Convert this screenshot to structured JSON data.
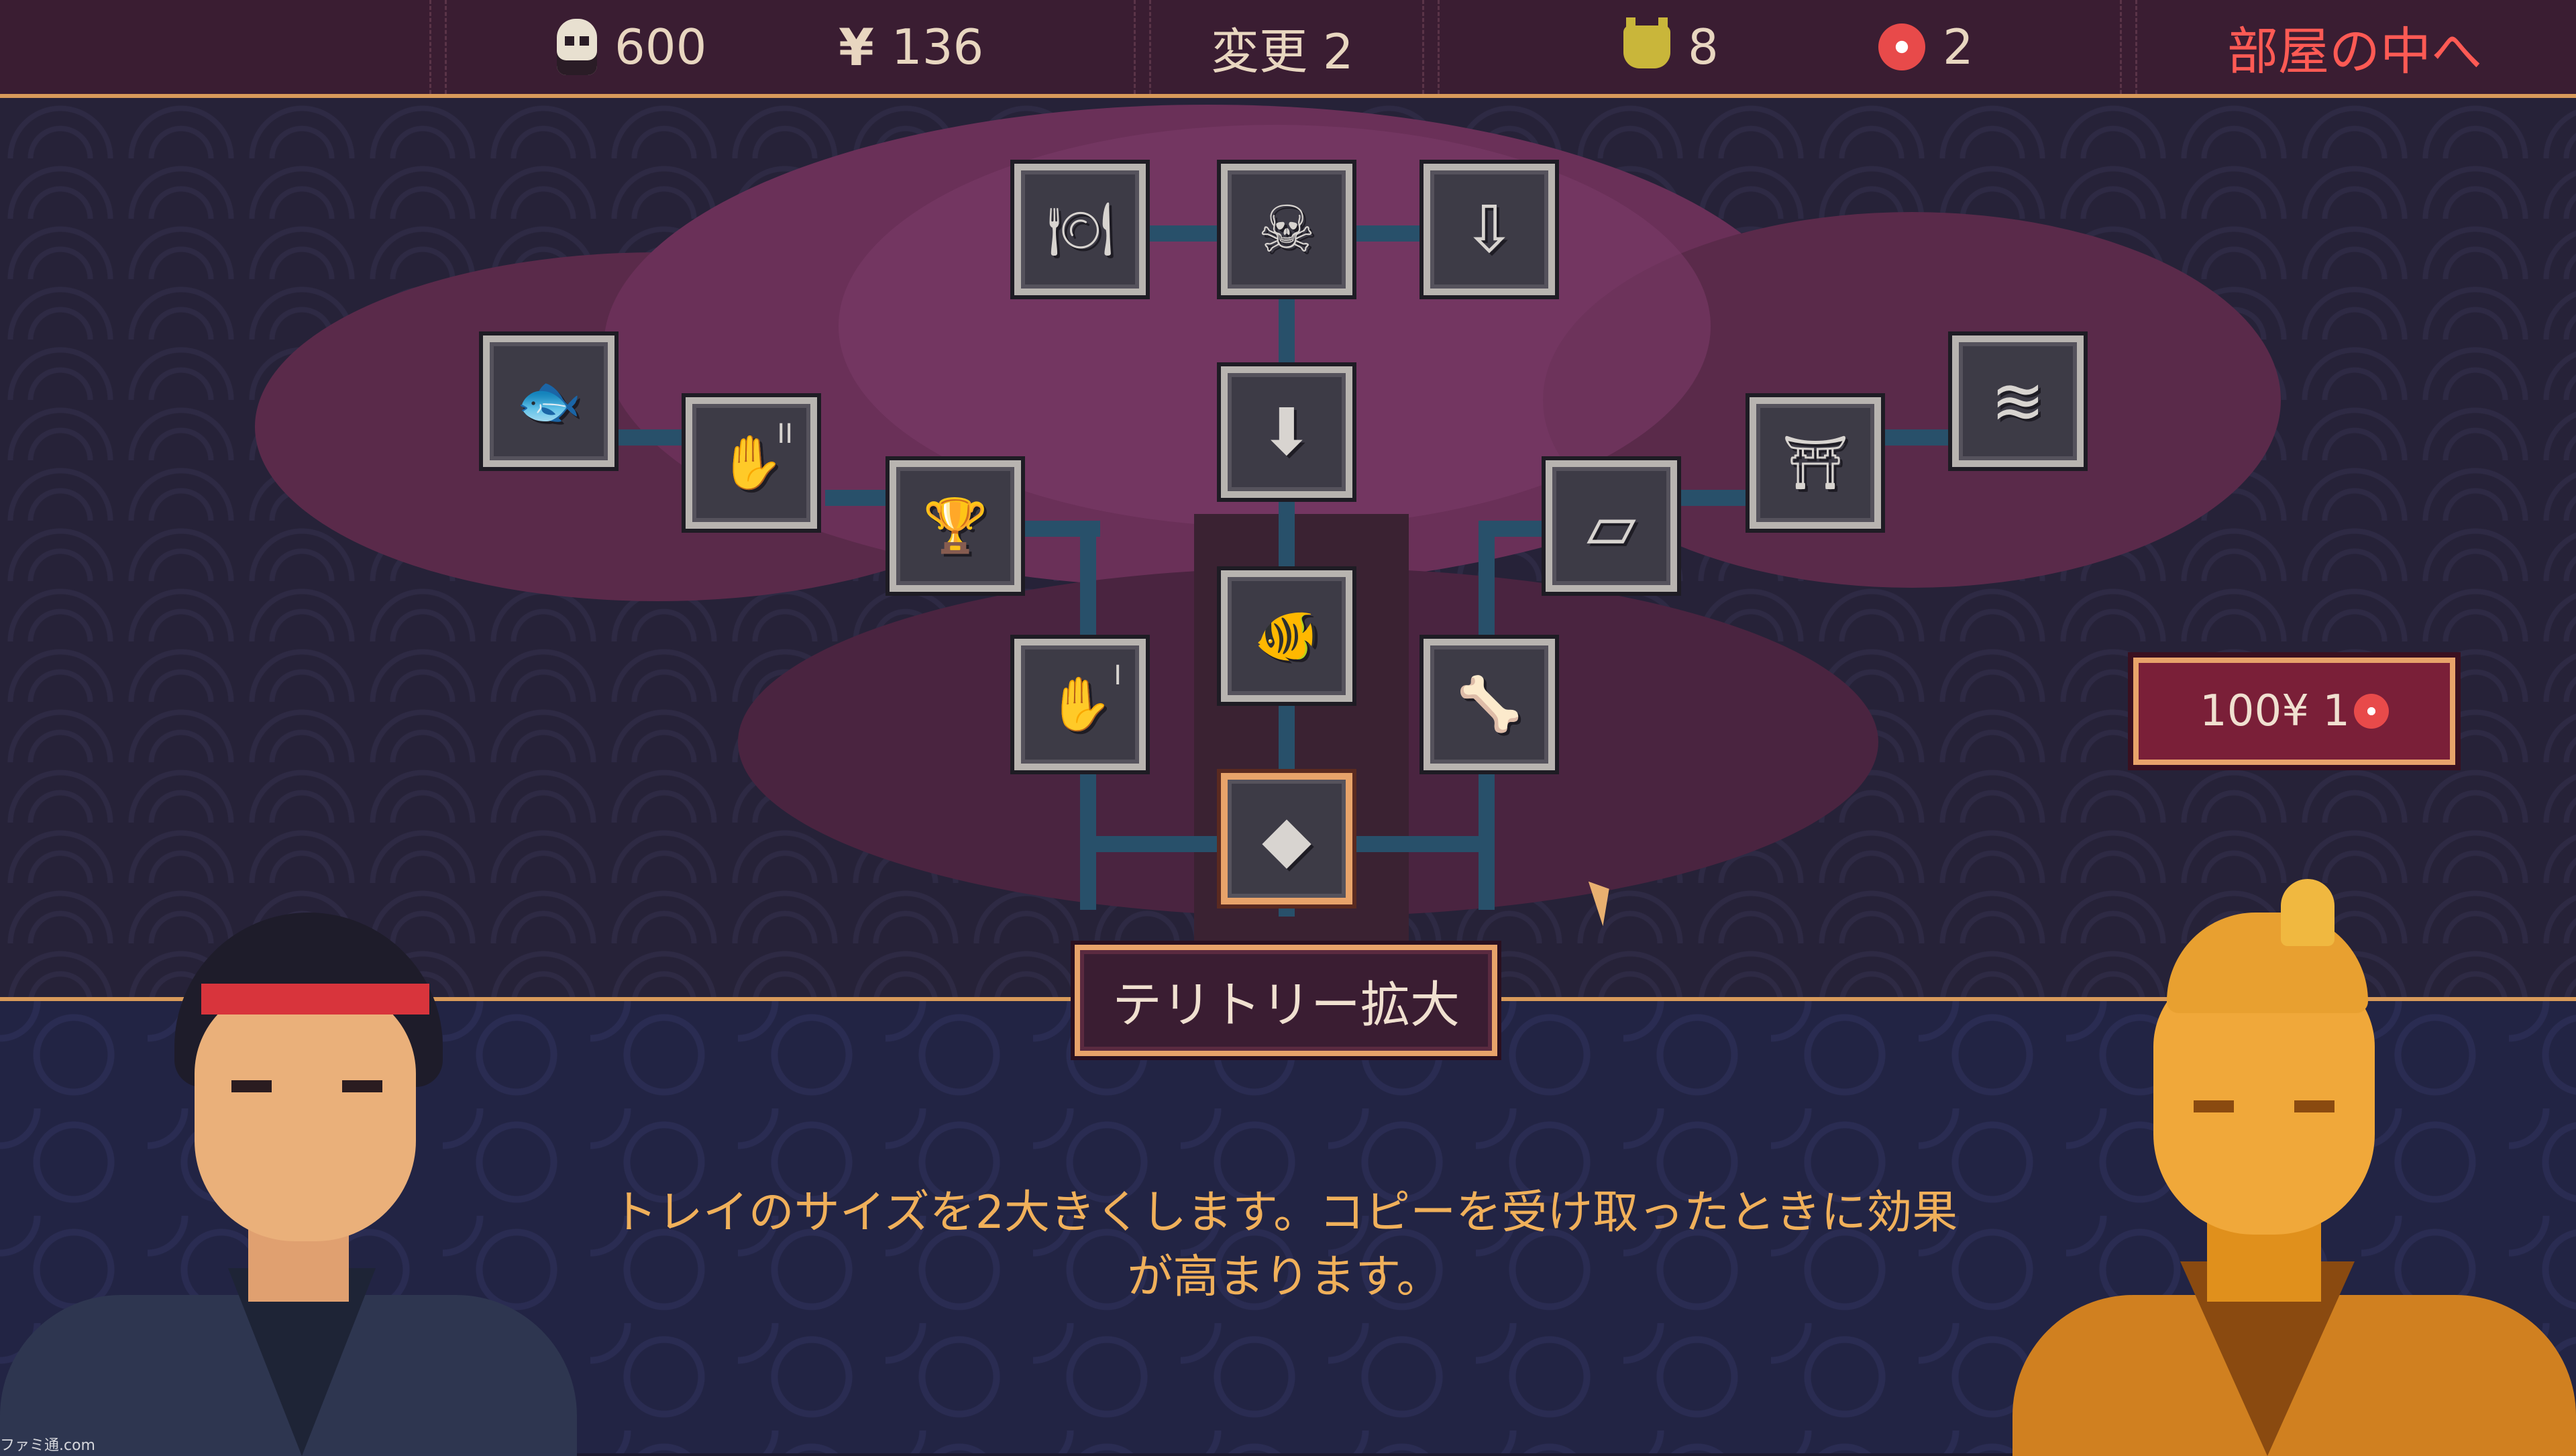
{
  "topbar": {
    "skulls": "600",
    "yen": "136",
    "yen_symbol": "¥",
    "changes": "変更 2",
    "oni": "8",
    "flowers": "2",
    "enter_room": "部屋の中へ"
  },
  "icons": {
    "skull": "skull-icon",
    "yen": "yen-icon",
    "oni": "oni-mask-icon",
    "flower": "flower-icon"
  },
  "skill_nodes": [
    {
      "id": "n1",
      "icon": "sushi-plate-icon",
      "glyph": "🍽"
    },
    {
      "id": "n2",
      "icon": "skull-tray-icon",
      "glyph": "☠"
    },
    {
      "id": "n3",
      "icon": "drop-skull-icon",
      "glyph": "⇩"
    },
    {
      "id": "n4",
      "icon": "winged-fish-icon",
      "glyph": "🐟"
    },
    {
      "id": "n5",
      "icon": "hand-ii-icon",
      "glyph": "✋",
      "sup": "II"
    },
    {
      "id": "n6",
      "icon": "goblet-icon",
      "glyph": "🏆"
    },
    {
      "id": "n7",
      "icon": "drop-tray-icon",
      "glyph": "⬇"
    },
    {
      "id": "n8",
      "icon": "tray-icon",
      "glyph": "▱"
    },
    {
      "id": "n9",
      "icon": "gate-icon",
      "glyph": "⛩"
    },
    {
      "id": "n10",
      "icon": "waterfall-icon",
      "glyph": "≋"
    },
    {
      "id": "n11",
      "icon": "koi-icon",
      "glyph": "🐠"
    },
    {
      "id": "n12",
      "icon": "hand-i-icon",
      "glyph": "✋",
      "sup": "I"
    },
    {
      "id": "n13",
      "icon": "fish-bones-icon",
      "glyph": "🦴"
    },
    {
      "id": "n14",
      "icon": "territory-expand-icon",
      "glyph": "◆"
    }
  ],
  "price": {
    "text": "100¥ 1"
  },
  "selected_skill": {
    "title": "テリトリー拡大",
    "description_line1": "トレイのサイズを2大きくします。コピーを受け取ったときに効果",
    "description_line2": "が高まります。"
  },
  "watermark": "ファミ通.com",
  "colors": {
    "accent": "#e8a36a",
    "enter_room": "#ff5a54",
    "description": "#f0b05a",
    "price_bg": "#7a1f38"
  }
}
